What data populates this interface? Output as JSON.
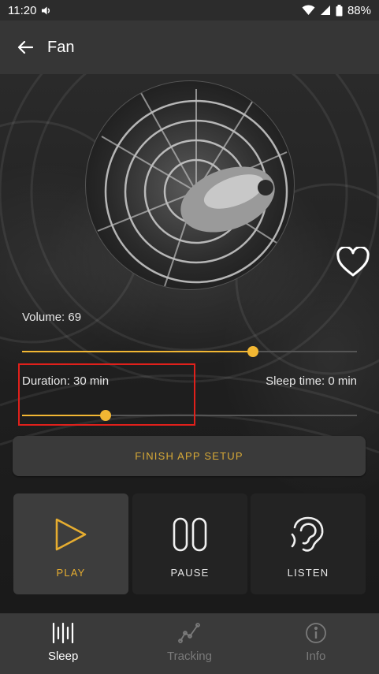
{
  "status_bar": {
    "time": "11:20",
    "battery": "88%",
    "icons": [
      "volume-icon",
      "wifi-icon",
      "signal-icon",
      "battery-icon"
    ]
  },
  "app_bar": {
    "title": "Fan",
    "back_icon": "arrow-back-icon"
  },
  "sound": {
    "image": "fan-image",
    "favorite_icon": "heart-outline-icon"
  },
  "volume": {
    "label": "Volume: 69",
    "value": 69,
    "max": 100
  },
  "duration": {
    "label": "Duration: 30 min",
    "fraction": 0.25
  },
  "sleep_time": {
    "label": "Sleep time: 0 min"
  },
  "finish_setup": {
    "label": "FINISH APP SETUP"
  },
  "controls": [
    {
      "label": "PLAY",
      "icon": "play-icon",
      "selected": true
    },
    {
      "label": "PAUSE",
      "icon": "pause-icon",
      "selected": false
    },
    {
      "label": "LISTEN",
      "icon": "ear-icon",
      "selected": false
    }
  ],
  "bottom_nav": [
    {
      "label": "Sleep",
      "icon": "sound-bars-icon",
      "active": true
    },
    {
      "label": "Tracking",
      "icon": "tracking-graph-icon",
      "active": false
    },
    {
      "label": "Info",
      "icon": "info-icon",
      "active": false
    }
  ],
  "colors": {
    "accent": "#f2b733",
    "play_accent": "#e6ad30",
    "highlight": "#e0201b",
    "appbar": "#363636",
    "nav_bg": "#3a3a3a"
  }
}
